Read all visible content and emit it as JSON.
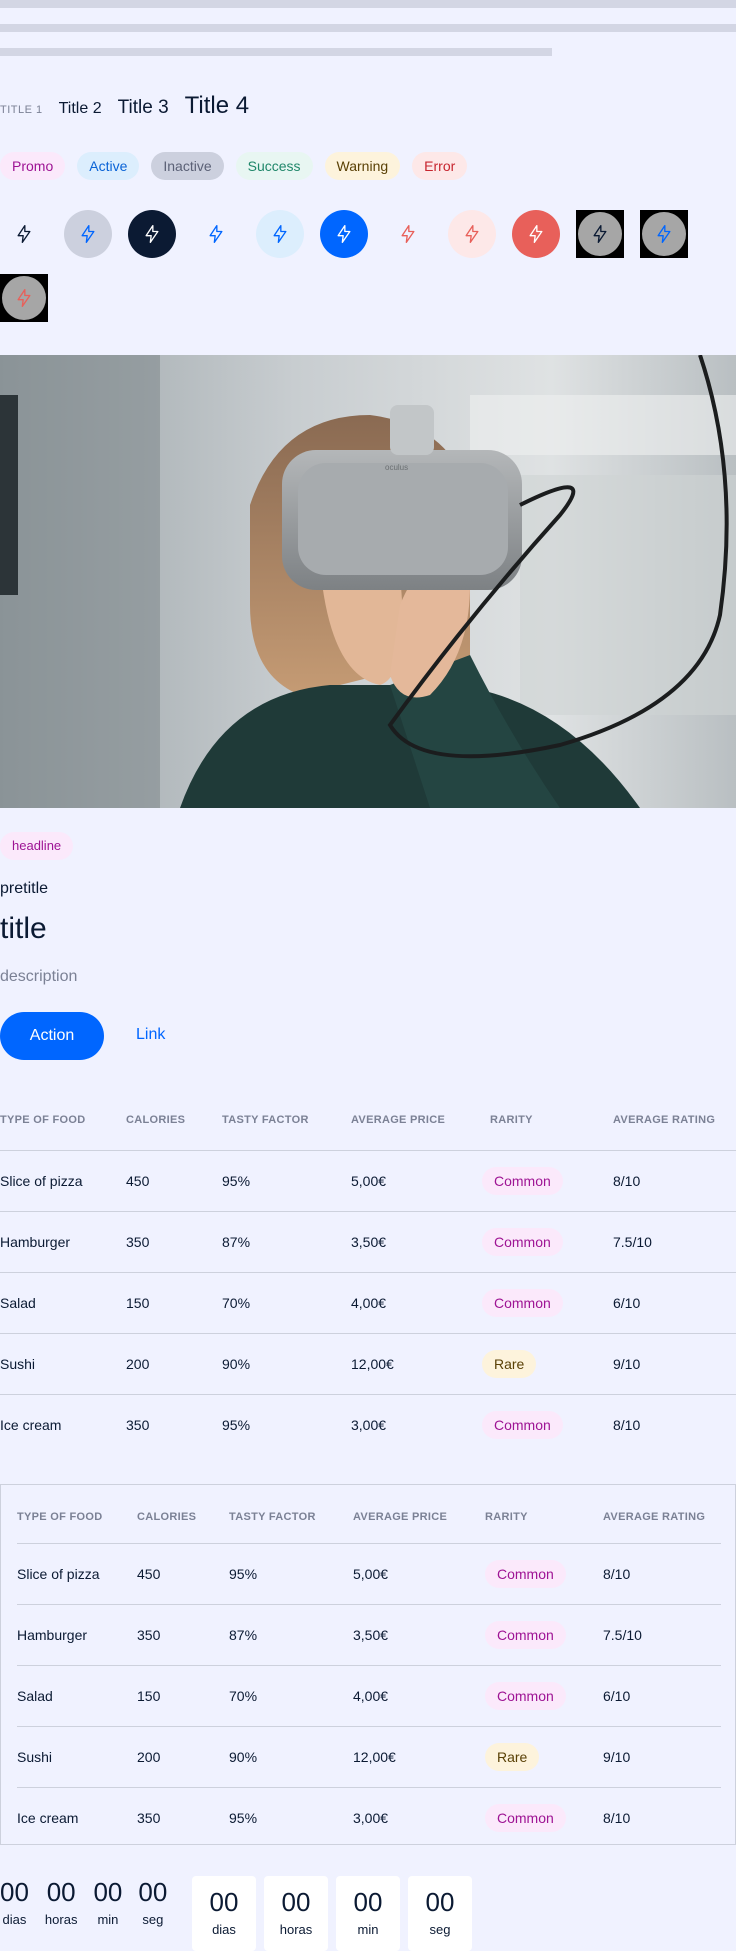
{
  "titles": {
    "t1": "TITLE 1",
    "t2": "Title 2",
    "t3": "Title 3",
    "t4": "Title 4"
  },
  "badges": [
    "Promo",
    "Active",
    "Inactive",
    "Success",
    "Warning",
    "Error"
  ],
  "icons": {
    "name": "lightning-icon",
    "colors": {
      "dark": "#0b1a33",
      "blue": "#0066ff",
      "red": "#e8605a",
      "white": "#ffffff"
    }
  },
  "hero": {
    "alt": "Person wearing a VR headset"
  },
  "card": {
    "headline": "headline",
    "pretitle": "pretitle",
    "title": "title",
    "description": "description",
    "action": "Action",
    "link": "Link"
  },
  "table": {
    "headers": [
      "TYPE OF FOOD",
      "CALORIES",
      "TASTY FACTOR",
      "AVERAGE PRICE",
      "RARITY",
      "AVERAGE RATING"
    ],
    "rows": [
      [
        "Slice of pizza",
        "450",
        "95%",
        "5,00€",
        "Common",
        "8/10"
      ],
      [
        "Hamburger",
        "350",
        "87%",
        "3,50€",
        "Common",
        "7.5/10"
      ],
      [
        "Salad",
        "150",
        "70%",
        "4,00€",
        "Common",
        "6/10"
      ],
      [
        "Sushi",
        "200",
        "90%",
        "12,00€",
        "Rare",
        "9/10"
      ],
      [
        "Ice cream",
        "350",
        "95%",
        "3,00€",
        "Common",
        "8/10"
      ]
    ]
  },
  "countdown": {
    "values": [
      "00",
      "00",
      "00",
      "00"
    ],
    "labels": [
      "dias",
      "horas",
      "min",
      "seg"
    ]
  }
}
